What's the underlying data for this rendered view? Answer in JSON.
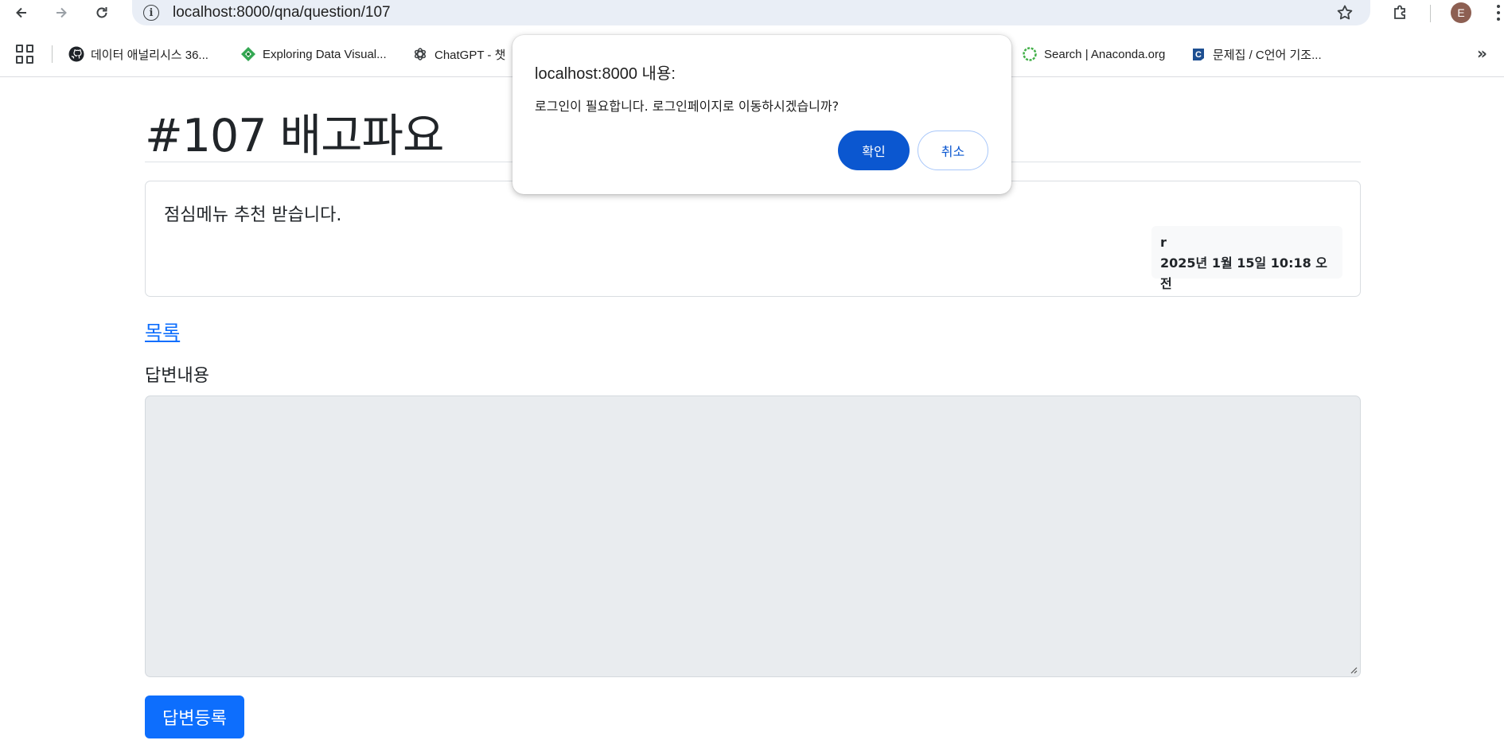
{
  "browser": {
    "url": "localhost:8000/qna/question/107",
    "avatar_letter": "E",
    "bookmarks": [
      {
        "label": "데이터 애널리시스 36...",
        "icon": "github-icon"
      },
      {
        "label": "Exploring Data Visual...",
        "icon": "diamond-logo-icon"
      },
      {
        "label": "ChatGPT - 챗",
        "icon": "openai-icon"
      },
      {
        "label": "Search | Anaconda.org",
        "icon": "anaconda-icon"
      },
      {
        "label": "문제집 / C언어 기조...",
        "icon": "c-logo-icon"
      }
    ]
  },
  "page": {
    "title": "#107 배고파요",
    "question_body": "점심메뉴 추천 받습니다.",
    "author": "r",
    "created": "2025년 1월 15일 10:18 오전",
    "list_link": "목록",
    "answer_label": "답변내용",
    "answer_value": "",
    "submit_label": "답변등록"
  },
  "dialog": {
    "title": "localhost:8000 내용:",
    "message": "로그인이 필요합니다. 로그인페이지로 이동하시겠습니까?",
    "ok_label": "확인",
    "cancel_label": "취소"
  },
  "colors": {
    "primary": "#0d6efd",
    "dialog_primary": "#0b57d0",
    "omnibox_bg": "#e9eef6"
  }
}
